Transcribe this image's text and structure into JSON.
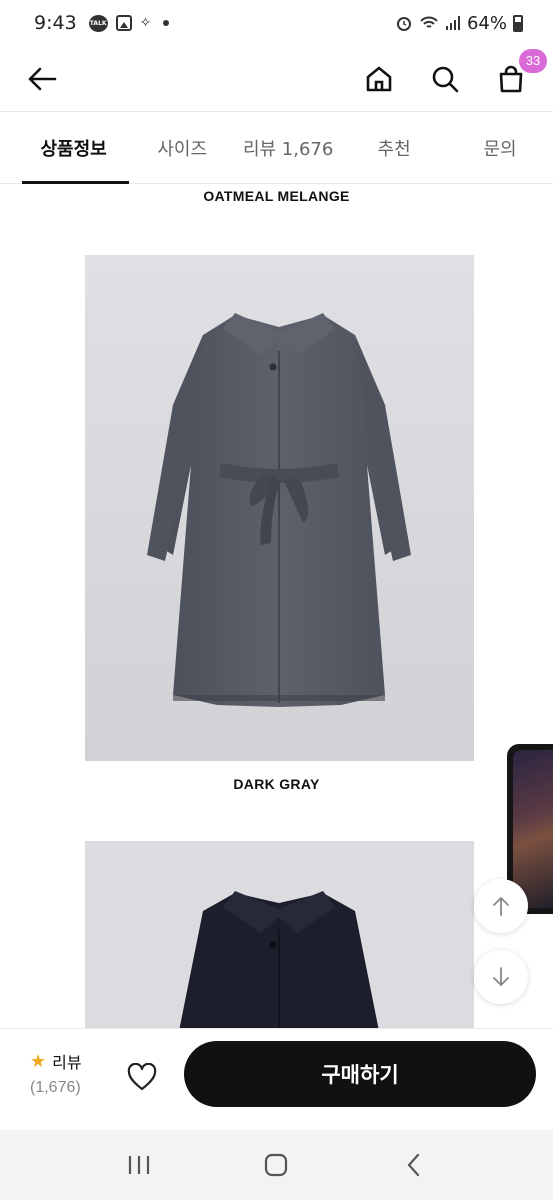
{
  "status_bar": {
    "time": "9:43",
    "talk_badge": "TALK",
    "battery": "64%"
  },
  "header": {
    "cart_count": "33",
    "badge_color": "#d96ad8"
  },
  "tabs": [
    {
      "label": "상품정보",
      "active": true
    },
    {
      "label": "사이즈",
      "active": false
    },
    {
      "label": "리뷰 1,676",
      "active": false
    },
    {
      "label": "추천",
      "active": false
    },
    {
      "label": "문의",
      "active": false
    }
  ],
  "content": {
    "captions": [
      "OATMEAL MELANGE",
      "DARK GRAY"
    ]
  },
  "action_bar": {
    "review_label": "리뷰",
    "review_count": "(1,676)",
    "buy_label": "구매하기",
    "star_color": "#f2a81d"
  },
  "icons": {
    "back": "arrow-left-icon",
    "home": "home-icon",
    "search": "search-icon",
    "cart": "shopping-bag-icon",
    "wishlist": "heart-icon",
    "scroll_up": "arrow-up-icon",
    "scroll_down": "arrow-down-icon"
  }
}
